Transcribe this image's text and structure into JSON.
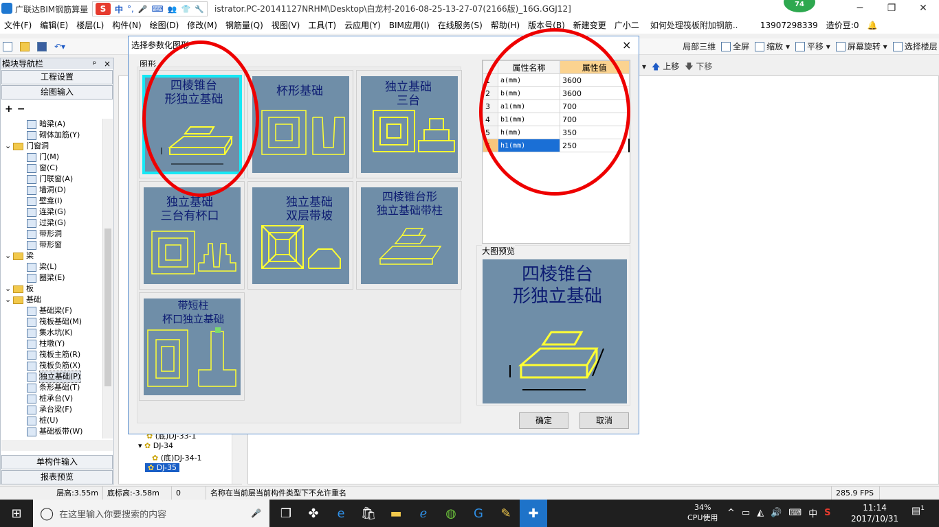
{
  "window": {
    "title_prefix": "广联达BIM钢筋算量",
    "title": "istrator.PC-20141127NRHM\\Desktop\\白龙村-2016-08-25-13-27-07(2166版)_16G.GGJ12]",
    "badge": "74",
    "ime": [
      "S",
      "中",
      "°,",
      "🎤",
      "⌨",
      "👥",
      "👕",
      "🔧"
    ]
  },
  "menu": [
    "文件(F)",
    "编辑(E)",
    "楼层(L)",
    "构件(N)",
    "绘图(D)",
    "修改(M)",
    "钢筋量(Q)",
    "视图(V)",
    "工具(T)",
    "云应用(Y)",
    "BIM应用(I)",
    "在线服务(S)",
    "帮助(H)",
    "版本号(B)",
    "新建变更",
    "广小二"
  ],
  "menu_right": {
    "question": "如何处理筏板附加钢筋..",
    "phone": "13907298339",
    "coins": "造价豆:0"
  },
  "toolbar": {
    "right": [
      "局部三维",
      "全屏",
      "缩放",
      "平移",
      "屏幕旋转",
      "选择楼层"
    ],
    "sub": [
      "上移",
      "下移"
    ]
  },
  "nav": {
    "header": "模块导航栏",
    "pin": "ᵖ",
    "close": "×",
    "btn_project": "工程设置",
    "btn_draw": "绘图输入",
    "btn_single": "单构件输入",
    "btn_report": "报表预览",
    "tree": [
      {
        "label": "暗梁(A)",
        "level": 2,
        "icon": "beam"
      },
      {
        "label": "砌体加筋(Y)",
        "level": 2,
        "icon": "rebar"
      },
      {
        "label": "门窗洞",
        "level": 1,
        "icon": "folder"
      },
      {
        "label": "门(M)",
        "level": 2,
        "icon": "door"
      },
      {
        "label": "窗(C)",
        "level": 2,
        "icon": "window"
      },
      {
        "label": "门联窗(A)",
        "level": 2,
        "icon": "doorwin"
      },
      {
        "label": "墙洞(D)",
        "level": 2,
        "icon": "hole"
      },
      {
        "label": "壁龛(I)",
        "level": 2,
        "icon": "niche"
      },
      {
        "label": "连梁(G)",
        "level": 2,
        "icon": "link"
      },
      {
        "label": "过梁(G)",
        "level": 2,
        "icon": "lintel"
      },
      {
        "label": "带形洞",
        "level": 2,
        "icon": "strip"
      },
      {
        "label": "带形窗",
        "level": 2,
        "icon": "stripwin"
      },
      {
        "label": "梁",
        "level": 1,
        "icon": "folder"
      },
      {
        "label": "梁(L)",
        "level": 2,
        "icon": "beam"
      },
      {
        "label": "圈梁(E)",
        "level": 2,
        "icon": "ring"
      },
      {
        "label": "板",
        "level": 1,
        "icon": "folder"
      },
      {
        "label": "基础",
        "level": 1,
        "icon": "folder"
      },
      {
        "label": "基础梁(F)",
        "level": 2,
        "icon": "fbeam"
      },
      {
        "label": "筏板基础(M)",
        "level": 2,
        "icon": "raft"
      },
      {
        "label": "集水坑(K)",
        "level": 2,
        "icon": "pit"
      },
      {
        "label": "柱墩(Y)",
        "level": 2,
        "icon": "pier"
      },
      {
        "label": "筏板主筋(R)",
        "level": 2,
        "icon": "main"
      },
      {
        "label": "筏板负筋(X)",
        "level": 2,
        "icon": "neg"
      },
      {
        "label": "独立基础(P)",
        "level": 2,
        "icon": "isolated",
        "selected": true
      },
      {
        "label": "条形基础(T)",
        "level": 2,
        "icon": "stripf"
      },
      {
        "label": "桩承台(V)",
        "level": 2,
        "icon": "cap"
      },
      {
        "label": "承台梁(F)",
        "level": 2,
        "icon": "capbeam"
      },
      {
        "label": "桩(U)",
        "level": 2,
        "icon": "pile"
      },
      {
        "label": "基础板带(W)",
        "level": 2,
        "icon": "band"
      }
    ]
  },
  "midtree": [
    {
      "label": "(底)DJ-33-1",
      "level": 2
    },
    {
      "label": "DJ-34",
      "level": 1
    },
    {
      "label": "(底)DJ-34-1",
      "level": 2
    },
    {
      "label": "DJ-35",
      "level": 1,
      "selected": true
    }
  ],
  "dialog": {
    "title": "选择参数化图形",
    "close": "×",
    "group_shapes": "图形",
    "shapes": [
      {
        "title": "四棱锥台形独立基础",
        "lines": [
          "四棱锥台",
          "形独立基础"
        ],
        "selected": true
      },
      {
        "title": "杯形基础",
        "lines": [
          "杯形基础"
        ]
      },
      {
        "title": "独立基础三台",
        "lines": [
          "独立基础",
          "三台"
        ]
      },
      {
        "title": "独立基础三台有杯口",
        "lines": [
          "独立基础",
          "三台有杯口"
        ]
      },
      {
        "title": "独立基础双层带坡",
        "lines": [
          "独立基础",
          "双层带坡"
        ]
      },
      {
        "title": "四棱锥台形独立基础带柱",
        "lines": [
          "四棱锥台形",
          "独立基础带柱"
        ]
      },
      {
        "title": "带短柱杯口独立基础",
        "lines": [
          "带短柱",
          "杯口独立基础"
        ]
      }
    ],
    "prop_header_name": "属性名称",
    "prop_header_value": "属性值",
    "props": [
      {
        "no": "1",
        "name": "a(mm)",
        "value": "3600"
      },
      {
        "no": "2",
        "name": "b(mm)",
        "value": "3600"
      },
      {
        "no": "3",
        "name": "a1(mm)",
        "value": "700"
      },
      {
        "no": "4",
        "name": "b1(mm)",
        "value": "700"
      },
      {
        "no": "5",
        "name": "h(mm)",
        "value": "350"
      },
      {
        "no": "6",
        "name": "h1(mm)",
        "value": "250",
        "active": true
      }
    ],
    "preview_label": "大图预览",
    "preview_lines": [
      "四棱锥台",
      "形独立基础"
    ],
    "ok": "确定",
    "cancel": "取消"
  },
  "status": [
    "层高:3.55m",
    "底标高:-3.58m",
    "0",
    "名称在当前层当前构件类型下不允许重名",
    "285.9 FPS"
  ],
  "taskbar": {
    "search_placeholder": "在这里输入你要搜索的内容",
    "cpu_pct": "34%",
    "cpu_label": "CPU使用",
    "ime": "中",
    "time": "11:14",
    "date": "2017/10/31",
    "notif": "1"
  },
  "colors": {
    "highlight_cyan": "#17e8f5",
    "annotation_red": "#e00000",
    "thumb_blue": "#6f8ea8",
    "shape_yellow": "#ffff33"
  }
}
